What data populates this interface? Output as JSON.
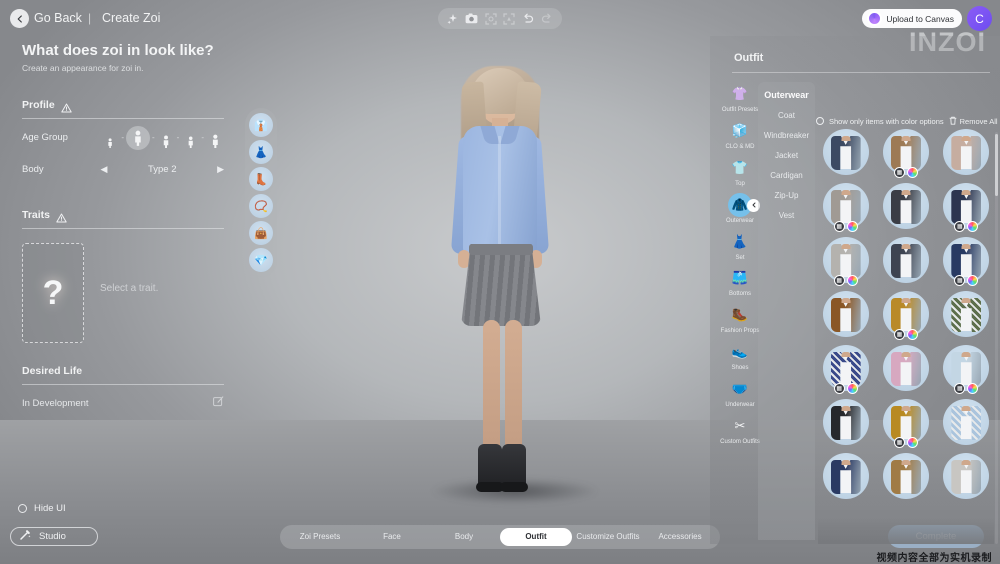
{
  "topbar": {
    "back_icon": "chevron-left-icon",
    "go_back": "Go Back",
    "separator": "|",
    "title": "Create Zoi",
    "tools": [
      {
        "name": "sparkle-icon",
        "glyph": "✦",
        "dim": false
      },
      {
        "name": "camera-icon",
        "glyph": "▣",
        "dim": false
      },
      {
        "name": "frame-focus-icon",
        "glyph": "⛶",
        "dim": true
      },
      {
        "name": "frame-expand-icon",
        "glyph": "⛶",
        "dim": true
      },
      {
        "name": "undo-icon",
        "glyph": "↶",
        "dim": false
      },
      {
        "name": "redo-icon",
        "glyph": "↷",
        "dim": true
      }
    ],
    "upload_label": "Upload to Canvas",
    "avatar_glyph": "C",
    "brand": "INZOI"
  },
  "left": {
    "question": "What does zoi in look like?",
    "subtitle": "Create an appearance for zoi in.",
    "profile_label": "Profile",
    "age_group_label": "Age Group",
    "age_selected_index": 1,
    "age_options": [
      "Infant",
      "Child",
      "Teen",
      "Adult",
      "Elder"
    ],
    "body_label": "Body",
    "body_value": "Type 2",
    "arrow_left": "◀",
    "arrow_right": "▶",
    "traits_label": "Traits",
    "trait_placeholder_glyph": "?",
    "trait_hint": "Select a trait.",
    "desired_life_label": "Desired Life",
    "desired_life_value": "In Development",
    "edit_icon": "edit-icon",
    "hide_ui_label": "Hide UI",
    "studio_label": "Studio",
    "studio_icon": "wand-icon"
  },
  "equipped": [
    {
      "name": "equipped-top",
      "glyph": "👔"
    },
    {
      "name": "equipped-skirt",
      "glyph": "👗"
    },
    {
      "name": "equipped-boots",
      "glyph": "👢"
    },
    {
      "name": "equipped-necklace",
      "glyph": "📿"
    },
    {
      "name": "equipped-bag",
      "glyph": "👜"
    },
    {
      "name": "equipped-earrings",
      "glyph": "💎"
    }
  ],
  "right": {
    "title": "Outfit",
    "filter_label": "Show only items with color options",
    "remove_all_label": "Remove All",
    "trash_icon": "trash-icon",
    "categories": [
      {
        "label": "Outfit Presets",
        "icon": "outfit-presets-icon",
        "glyph": "👚",
        "active": false
      },
      {
        "label": "CLO & MD",
        "icon": "clo-md-icon",
        "glyph": "🧊",
        "active": false
      },
      {
        "label": "Top",
        "icon": "top-icon",
        "glyph": "👕",
        "active": false
      },
      {
        "label": "Outerwear",
        "icon": "outerwear-icon",
        "glyph": "🧥",
        "active": true
      },
      {
        "label": "Set",
        "icon": "set-icon",
        "glyph": "👗",
        "active": false
      },
      {
        "label": "Bottoms",
        "icon": "bottoms-icon",
        "glyph": "🩳",
        "active": false
      },
      {
        "label": "Fashion Props",
        "icon": "fashion-props-icon",
        "glyph": "🥾",
        "active": false
      },
      {
        "label": "Shoes",
        "icon": "shoes-icon",
        "glyph": "👟",
        "active": false
      },
      {
        "label": "Underwear",
        "icon": "underwear-icon",
        "glyph": "🩲",
        "active": false
      },
      {
        "label": "Custom Outfits",
        "icon": "custom-outfits-icon",
        "glyph": "✂",
        "active": false
      }
    ],
    "collapse_icon": "chevron-left-icon",
    "sub_header": "Outerwear",
    "subcategories": [
      "Coat",
      "Windbreaker",
      "Jacket",
      "Cardigan",
      "Zip-Up",
      "Vest"
    ],
    "items": [
      {
        "name": "navy-blazer",
        "color": "#3c4a63",
        "pattern": false,
        "has_color_options": false
      },
      {
        "name": "tan-blazer",
        "color": "#9d7a55",
        "pattern": false,
        "has_color_options": true
      },
      {
        "name": "beige-blazer",
        "color": "#c6ada0",
        "pattern": false,
        "has_color_options": false
      },
      {
        "name": "grey-blazer",
        "color": "#a09a94",
        "pattern": false,
        "has_color_options": true
      },
      {
        "name": "charcoal-blazer",
        "color": "#3a3d46",
        "pattern": false,
        "has_color_options": false
      },
      {
        "name": "dark-navy-blazer",
        "color": "#2c3550",
        "pattern": false,
        "has_color_options": true
      },
      {
        "name": "light-grey-blazer",
        "color": "#b4b2ae",
        "pattern": false,
        "has_color_options": true
      },
      {
        "name": "slate-blazer",
        "color": "#3e4452",
        "pattern": false,
        "has_color_options": false
      },
      {
        "name": "indigo-blazer",
        "color": "#283a63",
        "pattern": false,
        "has_color_options": true
      },
      {
        "name": "brown-velvet",
        "color": "#8a5726",
        "pattern": false,
        "has_color_options": false
      },
      {
        "name": "mustard-blazer",
        "color": "#b98a28",
        "pattern": false,
        "has_color_options": true
      },
      {
        "name": "floral-green",
        "color": "#5d6f4c",
        "pattern": true,
        "has_color_options": false
      },
      {
        "name": "floral-blue",
        "color": "#3a4a8a",
        "pattern": true,
        "has_color_options": true
      },
      {
        "name": "pink-cardigan",
        "color": "#d7a8c0",
        "pattern": false,
        "has_color_options": false
      },
      {
        "name": "ice-blue-coat",
        "color": "#c3d6e4",
        "pattern": false,
        "has_color_options": true
      },
      {
        "name": "black-bomber",
        "color": "#26282c",
        "pattern": false,
        "has_color_options": false
      },
      {
        "name": "gold-bomber",
        "color": "#b88a22",
        "pattern": false,
        "has_color_options": true
      },
      {
        "name": "embroidered-blue",
        "color": "#aac4dd",
        "pattern": true,
        "has_color_options": false
      },
      {
        "name": "navy-varsity",
        "color": "#2a3a63",
        "pattern": false,
        "has_color_options": false
      },
      {
        "name": "camel-jacket",
        "color": "#a07b46",
        "pattern": false,
        "has_color_options": false
      },
      {
        "name": "pale-jacket",
        "color": "#c8c6c2",
        "pattern": false,
        "has_color_options": false
      }
    ]
  },
  "bottom": {
    "tabs": [
      {
        "label": "Zoi Presets",
        "active": false
      },
      {
        "label": "Face",
        "active": false
      },
      {
        "label": "Body",
        "active": false
      },
      {
        "label": "Outfit",
        "active": true
      },
      {
        "label": "Customize Outfits",
        "active": false
      },
      {
        "label": "Accessories",
        "active": false
      }
    ],
    "complete_label": "Complete",
    "watermark": "视频内容全部为实机录制"
  }
}
